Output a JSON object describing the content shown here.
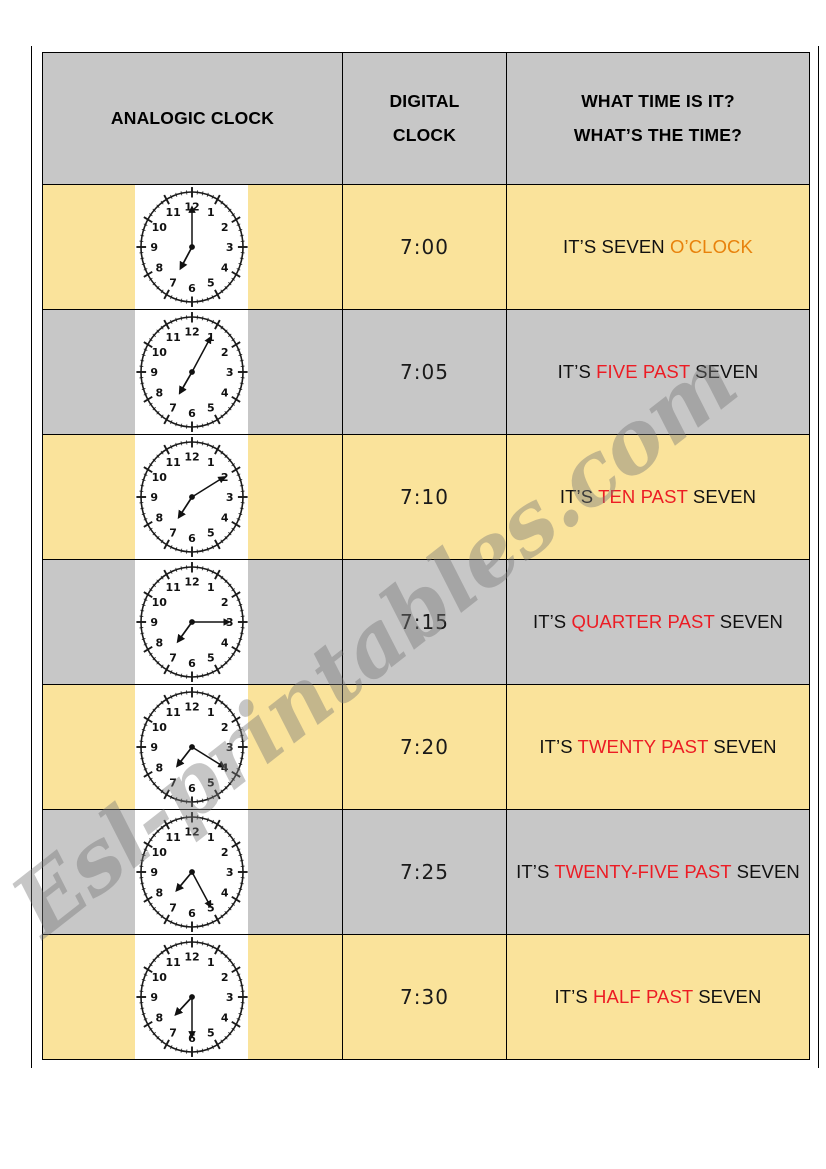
{
  "header": {
    "analog_label": "ANALOGIC CLOCK",
    "digital_label_line1": "DIGITAL",
    "digital_label_line2": "CLOCK",
    "question_line1": "WHAT TIME IS IT?",
    "question_line2": "WHAT’S THE TIME?"
  },
  "colors": {
    "header_bg": "#c7c7c7",
    "row_yellow": "#fae39b",
    "row_gray": "#c7c7c7",
    "highlight_red": "#ec1c24",
    "highlight_orange": "#e8820c",
    "text": "#111111",
    "border": "#000000"
  },
  "watermark": {
    "text": "Esl-printables.com"
  },
  "rows": [
    {
      "row_shade": "yellow",
      "digital": "7:00",
      "clock": {
        "hour_angle": 210,
        "minute_angle": 0,
        "icon": "analog-clock-icon"
      },
      "phrase_plain_1": "IT’S SEVEN ",
      "phrase_highlight": "O’CLOCK",
      "phrase_plain_2": "",
      "highlight_color": "orange",
      "phrase_full": "IT’S SEVEN O’CLOCK"
    },
    {
      "row_shade": "gray",
      "digital": "7:05",
      "clock": {
        "hour_angle": 212,
        "minute_angle": 30,
        "icon": "analog-clock-icon"
      },
      "phrase_plain_1": "IT’S ",
      "phrase_highlight": "FIVE PAST",
      "phrase_plain_2": " SEVEN",
      "highlight_color": "red",
      "phrase_full": "IT’S FIVE PAST SEVEN"
    },
    {
      "row_shade": "yellow",
      "digital": "7:10",
      "clock": {
        "hour_angle": 215,
        "minute_angle": 60,
        "icon": "analog-clock-icon"
      },
      "phrase_plain_1": "IT’S ",
      "phrase_highlight": "TEN PAST",
      "phrase_plain_2": " SEVEN",
      "highlight_color": "red",
      "phrase_full": "IT’S TEN PAST SEVEN"
    },
    {
      "row_shade": "gray",
      "digital": "7:15",
      "clock": {
        "hour_angle": 218,
        "minute_angle": 90,
        "icon": "analog-clock-icon"
      },
      "phrase_plain_1": "IT’S ",
      "phrase_highlight": "QUARTER PAST",
      "phrase_plain_2": " SEVEN",
      "highlight_color": "red",
      "phrase_full": "IT’S QUARTER PAST SEVEN"
    },
    {
      "row_shade": "yellow",
      "digital": "7:20",
      "clock": {
        "hour_angle": 220,
        "minute_angle": 120,
        "icon": "analog-clock-icon"
      },
      "phrase_plain_1": "IT’S ",
      "phrase_highlight": "TWENTY PAST",
      "phrase_plain_2": " SEVEN",
      "highlight_color": "red",
      "phrase_full": "IT’S TWENTY PAST SEVEN"
    },
    {
      "row_shade": "gray",
      "digital": "7:25",
      "clock": {
        "hour_angle": 222,
        "minute_angle": 150,
        "icon": "analog-clock-icon"
      },
      "phrase_plain_1": "IT’S ",
      "phrase_highlight": "TWENTY-FIVE PAST",
      "phrase_plain_2": " SEVEN",
      "highlight_color": "red",
      "phrase_full": "IT’S TWENTY-FIVE PAST SEVEN"
    },
    {
      "row_shade": "yellow",
      "digital": "7:30",
      "clock": {
        "hour_angle": 225,
        "minute_angle": 180,
        "icon": "analog-clock-icon"
      },
      "phrase_plain_1": "IT’S ",
      "phrase_highlight": "HALF PAST",
      "phrase_plain_2": " SEVEN",
      "highlight_color": "red",
      "phrase_full": "IT’S HALF PAST SEVEN"
    }
  ]
}
